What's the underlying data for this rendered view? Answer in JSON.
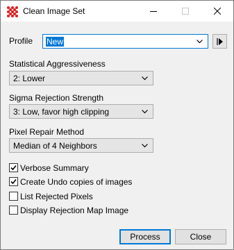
{
  "window": {
    "title": "Clean Image Set",
    "app_icon": "mira-grid-icon",
    "controls": [
      "minimize-icon",
      "maximize-icon",
      "close-icon"
    ]
  },
  "profile": {
    "label": "Profile",
    "value": "New",
    "menu_icon": "play-arrow-icon"
  },
  "statistical": {
    "label": "Statistical Aggressiveness",
    "value": "2:  Lower"
  },
  "sigma": {
    "label": "Sigma Rejection Strength",
    "value": "3:  Low, favor high clipping"
  },
  "pixel_repair": {
    "label": "Pixel Repair Method",
    "value": "Median of 4 Neighbors"
  },
  "options": [
    {
      "label": "Verbose Summary",
      "checked": true
    },
    {
      "label": "Create Undo copies of images",
      "checked": true
    },
    {
      "label": "List Rejected Pixels",
      "checked": false
    },
    {
      "label": "Display Rejection Map Image",
      "checked": false
    }
  ],
  "buttons": {
    "process": "Process",
    "close": "Close"
  },
  "colors": {
    "accent": "#0078d7",
    "icon_red": "#e02020",
    "face": "#f0f0f0"
  }
}
